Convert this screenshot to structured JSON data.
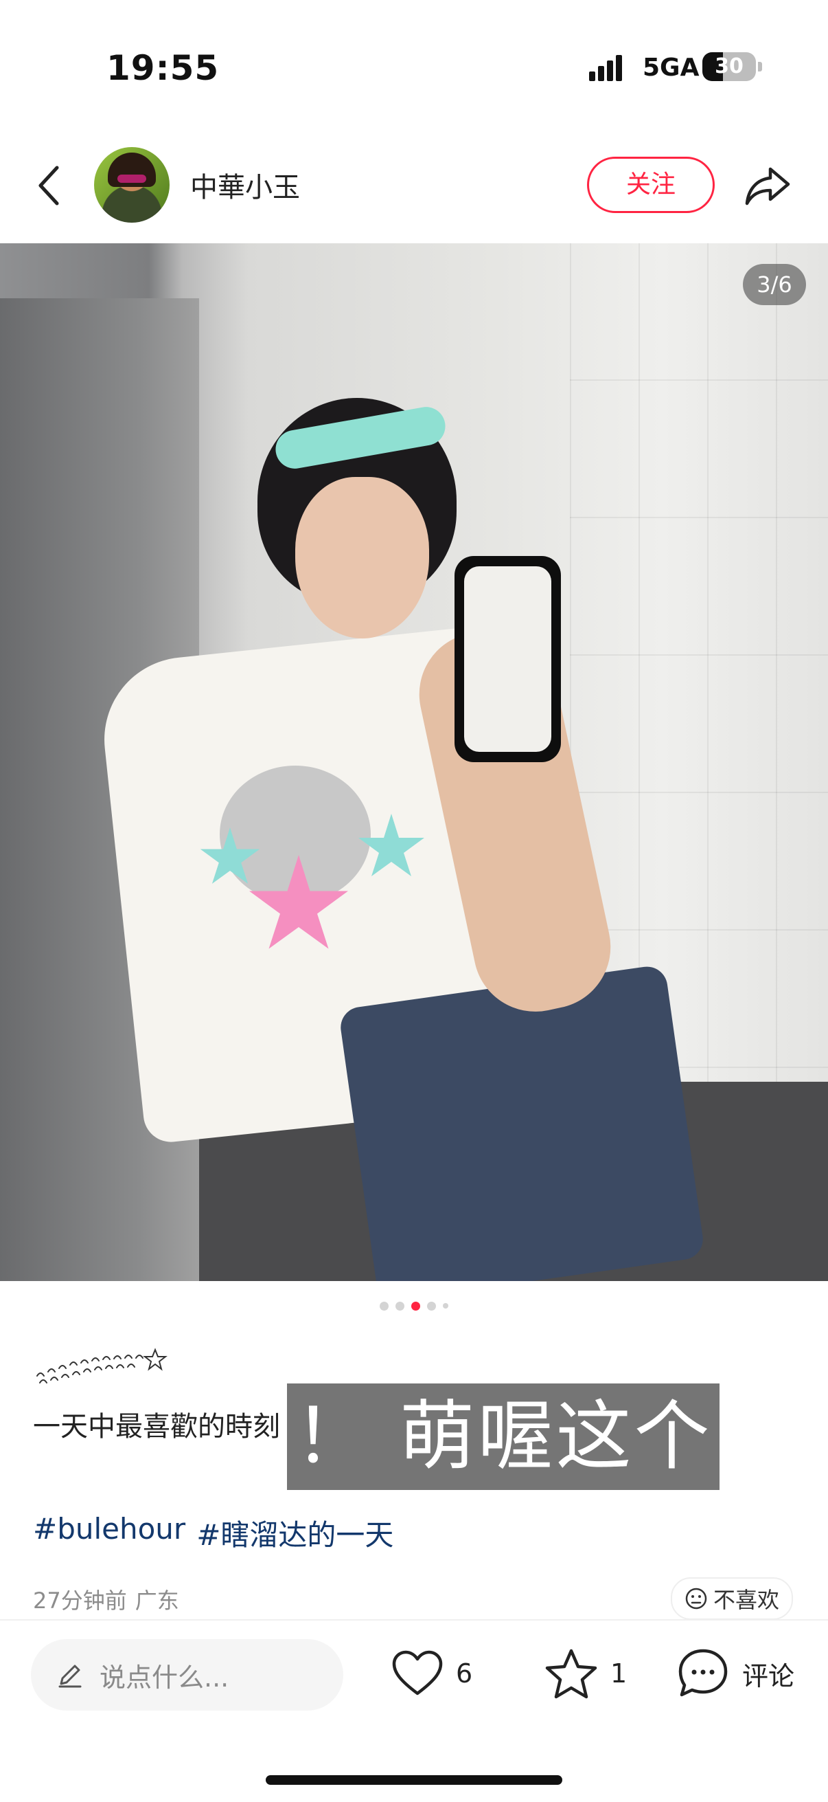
{
  "status_bar": {
    "time": "19:55",
    "network": "5GA",
    "battery": "30"
  },
  "header": {
    "author_name": "中華小玉",
    "follow_label": "关注"
  },
  "photo": {
    "page_counter": "3/6",
    "current_index": 3,
    "total": 6
  },
  "post": {
    "description": "一天中最喜歡的時刻",
    "overlay_label": "！ 萌喔这个",
    "tags": [
      "#bulehour",
      "#瞎溜达的一天"
    ],
    "time_ago": "27分钟前",
    "location": "广东",
    "dislike_label": "不喜欢"
  },
  "bottom_bar": {
    "comment_placeholder": "说点什么...",
    "likes": "6",
    "collects": "1",
    "comment_label": "评论"
  },
  "icons": {
    "back": "back-arrow-icon",
    "share": "share-icon",
    "like": "heart-icon",
    "collect": "star-icon",
    "comment": "comment-bubble-icon",
    "dislike": "neutral-face-icon",
    "pen": "pen-icon"
  },
  "colors": {
    "accent": "#ff2442",
    "tag": "#13386c"
  }
}
